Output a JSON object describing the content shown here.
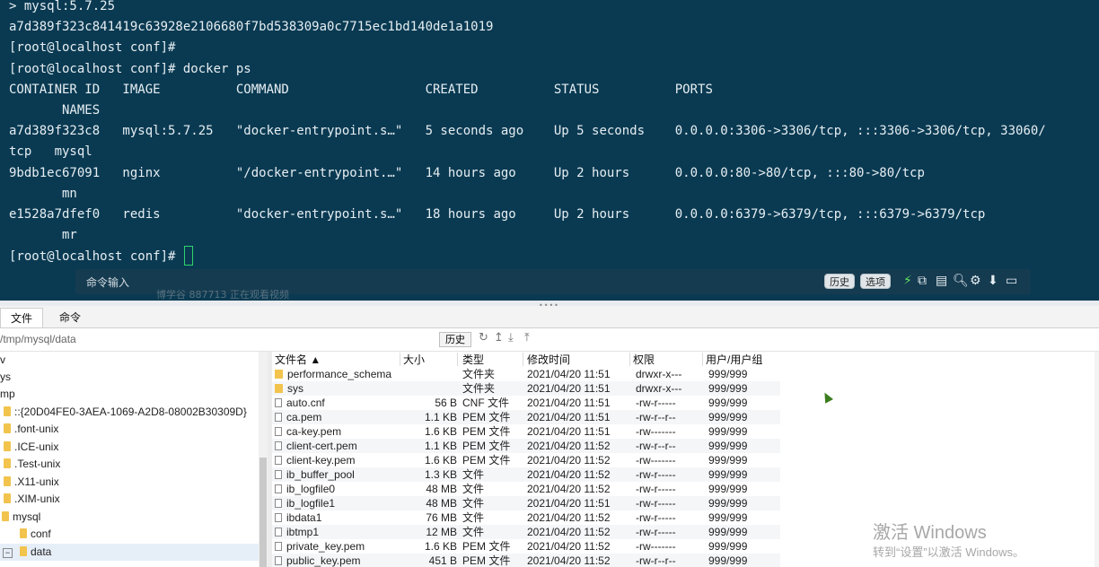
{
  "terminal": {
    "lines": [
      "> mysql:5.7.25",
      "a7d389f323c841419c63928e2106680f7bd538309a0c7715ec1bd140de1a1019",
      "[root@localhost conf]#",
      "[root@localhost conf]# docker ps",
      "CONTAINER ID   IMAGE          COMMAND                  CREATED          STATUS          PORTS",
      "       NAMES",
      "a7d389f323c8   mysql:5.7.25   \"docker-entrypoint.s…\"   5 seconds ago    Up 5 seconds    0.0.0.0:3306->3306/tcp, :::3306->3306/tcp, 33060/",
      "tcp   mysql",
      "9bdb1ec67091   nginx          \"/docker-entrypoint.…\"   14 hours ago     Up 2 hours      0.0.0.0:80->80/tcp, :::80->80/tcp",
      "       mn",
      "e1528a7dfef0   redis          \"docker-entrypoint.s…\"   18 hours ago     Up 2 hours      0.0.0.0:6379->6379/tcp, :::6379->6379/tcp",
      "       mr",
      "[root@localhost conf]# "
    ],
    "cursor_color": "#2fd36b",
    "background": "#0a3a52"
  },
  "cmdbar": {
    "label": "命令输入",
    "watch_note": "博学谷 887713 正在观看视频",
    "history_button": "历史",
    "options_button": "选项",
    "icons": [
      "lightning-icon",
      "copy-icon",
      "paste-icon",
      "search-icon",
      "gear-icon",
      "download-icon",
      "window-icon"
    ]
  },
  "tabs": [
    {
      "label": "文件",
      "active": true
    },
    {
      "label": "命令",
      "active": false
    }
  ],
  "path": {
    "value": "/tmp/mysql/data",
    "history_button": "历史",
    "tools": [
      "refresh-icon",
      "up-icon",
      "download-icon",
      "upload-icon"
    ]
  },
  "tree": [
    {
      "label": "v"
    },
    {
      "label": "ys"
    },
    {
      "label": "mp"
    },
    {
      "label": "::{20D04FE0-3AEA-1069-A2D8-08002B30309D}"
    },
    {
      "label": ".font-unix"
    },
    {
      "label": ".ICE-unix"
    },
    {
      "label": ".Test-unix"
    },
    {
      "label": ".X11-unix"
    },
    {
      "label": ".XIM-unix"
    },
    {
      "label": "mysql"
    },
    {
      "label": "conf"
    },
    {
      "label": "data"
    }
  ],
  "files": {
    "headers": [
      "文件名 ▲",
      "大小",
      "类型",
      "修改时间",
      "权限",
      "用户/用户组"
    ],
    "rows": [
      {
        "name": "performance_schema",
        "size": "",
        "type": "文件夹",
        "mtime": "2021/04/20 11:51",
        "perm": "drwxr-x---",
        "owner": "999/999",
        "folder": true
      },
      {
        "name": "sys",
        "size": "",
        "type": "文件夹",
        "mtime": "2021/04/20 11:51",
        "perm": "drwxr-x---",
        "owner": "999/999",
        "folder": true
      },
      {
        "name": "auto.cnf",
        "size": "56 B",
        "type": "CNF 文件",
        "mtime": "2021/04/20 11:51",
        "perm": "-rw-r-----",
        "owner": "999/999",
        "folder": false
      },
      {
        "name": "ca.pem",
        "size": "1.1 KB",
        "type": "PEM 文件",
        "mtime": "2021/04/20 11:51",
        "perm": "-rw-r--r--",
        "owner": "999/999",
        "folder": false
      },
      {
        "name": "ca-key.pem",
        "size": "1.6 KB",
        "type": "PEM 文件",
        "mtime": "2021/04/20 11:51",
        "perm": "-rw-------",
        "owner": "999/999",
        "folder": false
      },
      {
        "name": "client-cert.pem",
        "size": "1.1 KB",
        "type": "PEM 文件",
        "mtime": "2021/04/20 11:52",
        "perm": "-rw-r--r--",
        "owner": "999/999",
        "folder": false
      },
      {
        "name": "client-key.pem",
        "size": "1.6 KB",
        "type": "PEM 文件",
        "mtime": "2021/04/20 11:52",
        "perm": "-rw-------",
        "owner": "999/999",
        "folder": false
      },
      {
        "name": "ib_buffer_pool",
        "size": "1.3 KB",
        "type": "文件",
        "mtime": "2021/04/20 11:52",
        "perm": "-rw-r-----",
        "owner": "999/999",
        "folder": false
      },
      {
        "name": "ib_logfile0",
        "size": "48 MB",
        "type": "文件",
        "mtime": "2021/04/20 11:52",
        "perm": "-rw-r-----",
        "owner": "999/999",
        "folder": false
      },
      {
        "name": "ib_logfile1",
        "size": "48 MB",
        "type": "文件",
        "mtime": "2021/04/20 11:51",
        "perm": "-rw-r-----",
        "owner": "999/999",
        "folder": false
      },
      {
        "name": "ibdata1",
        "size": "76 MB",
        "type": "文件",
        "mtime": "2021/04/20 11:52",
        "perm": "-rw-r-----",
        "owner": "999/999",
        "folder": false
      },
      {
        "name": "ibtmp1",
        "size": "12 MB",
        "type": "文件",
        "mtime": "2021/04/20 11:52",
        "perm": "-rw-r-----",
        "owner": "999/999",
        "folder": false
      },
      {
        "name": "private_key.pem",
        "size": "1.6 KB",
        "type": "PEM 文件",
        "mtime": "2021/04/20 11:52",
        "perm": "-rw-------",
        "owner": "999/999",
        "folder": false
      },
      {
        "name": "public_key.pem",
        "size": "451 B",
        "type": "PEM 文件",
        "mtime": "2021/04/20 11:52",
        "perm": "-rw-r--r--",
        "owner": "999/999",
        "folder": false
      }
    ]
  },
  "activation": {
    "title": "激活 Windows",
    "subtitle": "转到“设置”以激活 Windows。"
  }
}
